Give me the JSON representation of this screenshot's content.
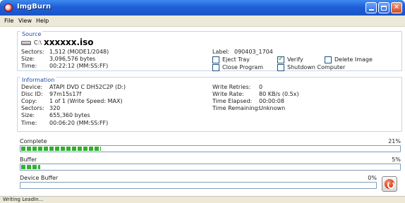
{
  "window": {
    "title": "ImgBurn"
  },
  "menu": {
    "file": "File",
    "view": "View",
    "help": "Help"
  },
  "source": {
    "title": "Source",
    "drive_prefix": "C:\\",
    "iso_name": "xxxxxx.iso",
    "sectors_label": "Sectors:",
    "sectors_value": "1,512 (MODE1/2048)",
    "size_label": "Size:",
    "size_value": "3,096,576 bytes",
    "time_label": "Time:",
    "time_value": "00:22:12 (MM:SS:FF)",
    "label_label": "Label:",
    "label_value": "090403_1704"
  },
  "options": {
    "eject_tray": {
      "label": "Eject Tray",
      "checked": false
    },
    "verify": {
      "label": "Verify",
      "checked": true
    },
    "delete_image": {
      "label": "Delete Image",
      "checked": false
    },
    "close_program": {
      "label": "Close Program",
      "checked": false
    },
    "shutdown": {
      "label": "Shutdown Computer",
      "checked": false
    }
  },
  "information": {
    "title": "Information",
    "device_label": "Device:",
    "device_value": "ATAPI DVD C DH52C2P (D:)",
    "disc_id_label": "Disc ID:",
    "disc_id_value": "97m15s17f",
    "copy_label": "Copy:",
    "copy_value": "1 of 1 (Write Speed: MAX)",
    "sectors_label": "Sectors:",
    "sectors_value": "320",
    "size_label": "Size:",
    "size_value": "655,360 bytes",
    "time_label": "Time:",
    "time_value": "00:06:20 (MM:SS:FF)",
    "write_retries_label": "Write Retries:",
    "write_retries_value": "0",
    "write_rate_label": "Write Rate:",
    "write_rate_value": "80 KB/s (0.5x)",
    "time_elapsed_label": "Time Elapsed:",
    "time_elapsed_value": "00:00:08",
    "time_remaining_label": "Time Remaining:",
    "time_remaining_value": "Unknown"
  },
  "progress": {
    "complete": {
      "label": "Complete",
      "pct_text": "21%",
      "fraction": 0.21
    },
    "buffer": {
      "label": "Buffer",
      "pct_text": "5%",
      "fraction": 0.05
    },
    "device_buffer": {
      "label": "Device Buffer",
      "pct_text": "0%",
      "fraction": 0.0
    }
  },
  "status": {
    "text": "Writing LeadIn..."
  },
  "colors": {
    "title_bar": "#1f5fd8",
    "progress": "#2fb12f",
    "group_title": "#1e4ea8"
  }
}
